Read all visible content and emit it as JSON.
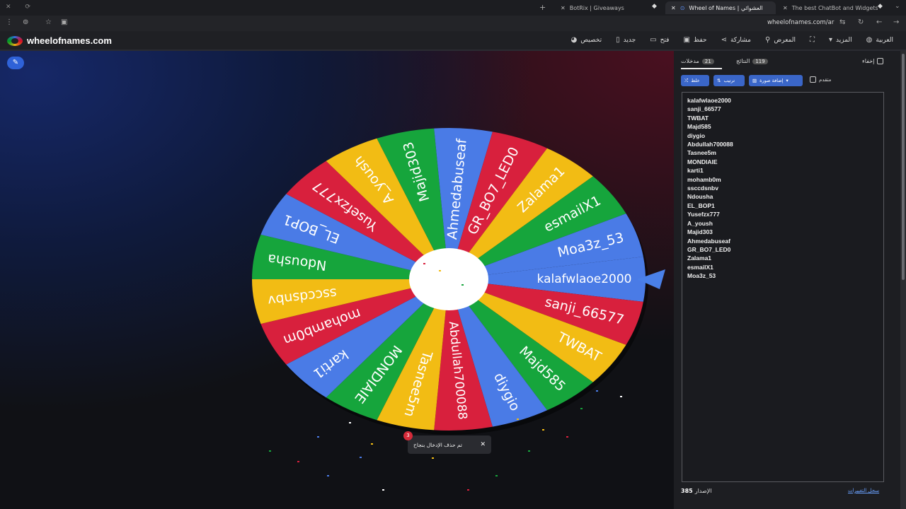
{
  "browser": {
    "tabs": [
      {
        "title": "BotRix | Giveaways",
        "active": false
      },
      {
        "title": "Wheel of Names | العشوائي",
        "active": true
      },
      {
        "title": "The best ChatBot and Widgets",
        "active": false
      }
    ],
    "url": "wheelofnames.com/ar"
  },
  "site": {
    "logo_text": "wheelofnames.com",
    "menu": [
      {
        "label": "تخصيص",
        "icon": "palette-icon"
      },
      {
        "label": "جديد",
        "icon": "new-file-icon"
      },
      {
        "label": "فتح",
        "icon": "folder-icon"
      },
      {
        "label": "حفظ",
        "icon": "save-icon"
      },
      {
        "label": "مشاركة",
        "icon": "share-icon"
      },
      {
        "label": "المعرض",
        "icon": "search-icon"
      },
      {
        "label": "",
        "icon": "fullscreen-icon"
      },
      {
        "label": "المزيد",
        "icon": "caret-down-icon"
      },
      {
        "label": "العربية",
        "icon": "globe-icon"
      }
    ]
  },
  "wheel": {
    "entries": [
      "kalafwlaoe2000",
      "sanji_66577",
      "TWBAT",
      "Majd585",
      "diygio",
      "Abdullah700088",
      "Tasnee5m",
      "MONDIAIE",
      "karti1",
      "mohamb0m",
      "ssccdsnbv",
      "Ndousha",
      "EL_BOP1",
      "Yusefzx777",
      "A_yoush",
      "Majid303",
      "Ahmedabuseaf",
      "GR_BO7_LED0",
      "Zalama1",
      "esmailX1",
      "Moa3z_53"
    ],
    "colors": {
      "blue": "#4a7be6",
      "red": "#d8203d",
      "yellow": "#f2bc14",
      "green": "#16a53c"
    },
    "color_cycle": [
      "blue",
      "red",
      "yellow",
      "green"
    ],
    "pointer_color": "#4a80e8"
  },
  "sidebar": {
    "tabs": [
      {
        "label": "مدخلات",
        "count": "21"
      },
      {
        "label": "النتائج",
        "count": "119"
      }
    ],
    "hide_label": "إخفاء",
    "tools": {
      "shuffle_label": "خلط",
      "sort_label": "ترتيب",
      "add_image_label": "إضافة صورة",
      "advanced_label": "متقدم"
    },
    "names": [
      "kalafwlaoe2000",
      "sanji_66577",
      "TWBAT",
      "Majd585",
      "diygio",
      "Abdullah700088",
      "Tasnee5m",
      "MONDIAIE",
      "karti1",
      "mohamb0m",
      "ssccdsnbv",
      "Ndousha",
      "EL_BOP1",
      "Yusefzx777",
      "A_yoush",
      "Majid303",
      "Ahmedabuseaf",
      "GR_BO7_LED0",
      "Zalama1",
      "esmailX1",
      "Moa3z_53"
    ],
    "changelog_label": "سجل التغييرات",
    "version_label": "الإصدار",
    "version": "385"
  },
  "toast": {
    "text": "تم حذف الإدخال بنجاح",
    "badge": "3"
  }
}
